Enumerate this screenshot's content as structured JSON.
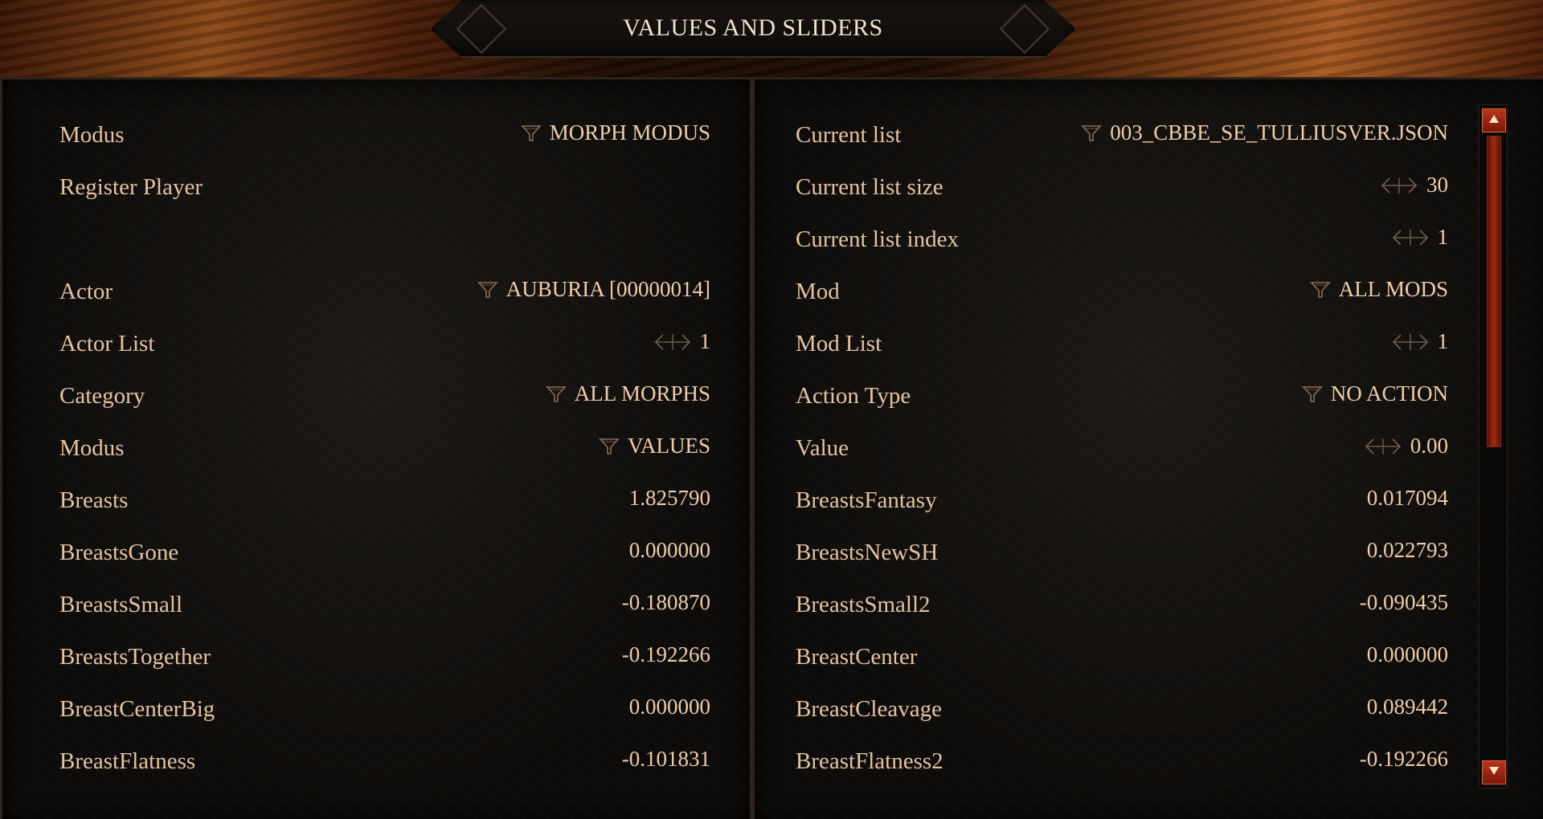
{
  "window": {
    "title": "VALUES AND SLIDERS"
  },
  "left_panel": {
    "rows": [
      {
        "label": "Modus",
        "value": "MORPH MODUS",
        "control": "dropdown"
      },
      {
        "label": "Register Player",
        "value": "",
        "control": "button"
      },
      {
        "label": "",
        "value": "",
        "control": "spacer"
      },
      {
        "label": "Actor",
        "value": "AUBURIA [00000014]",
        "control": "dropdown"
      },
      {
        "label": "Actor List",
        "value": "1",
        "control": "stepper"
      },
      {
        "label": "Category",
        "value": "ALL MORPHS",
        "control": "dropdown"
      },
      {
        "label": "Modus",
        "value": "VALUES",
        "control": "dropdown"
      },
      {
        "label": "Breasts",
        "value": "1.825790",
        "control": "value"
      },
      {
        "label": "BreastsGone",
        "value": "0.000000",
        "control": "value"
      },
      {
        "label": "BreastsSmall",
        "value": "-0.180870",
        "control": "value"
      },
      {
        "label": "BreastsTogether",
        "value": "-0.192266",
        "control": "value"
      },
      {
        "label": "BreastCenterBig",
        "value": "0.000000",
        "control": "value"
      },
      {
        "label": "BreastFlatness",
        "value": "-0.101831",
        "control": "value"
      }
    ]
  },
  "right_panel": {
    "rows": [
      {
        "label": "Current list",
        "value": "003_CBBE_SE_TULLIUSVER.JSON",
        "control": "dropdown"
      },
      {
        "label": "Current list size",
        "value": "30",
        "control": "stepper"
      },
      {
        "label": "Current list index",
        "value": "1",
        "control": "stepper"
      },
      {
        "label": "Mod",
        "value": "ALL MODS",
        "control": "dropdown"
      },
      {
        "label": "Mod List",
        "value": "1",
        "control": "stepper"
      },
      {
        "label": "Action Type",
        "value": "NO ACTION",
        "control": "dropdown"
      },
      {
        "label": "Value",
        "value": "0.00",
        "control": "stepper"
      },
      {
        "label": "BreastsFantasy",
        "value": "0.017094",
        "control": "value"
      },
      {
        "label": "BreastsNewSH",
        "value": "0.022793",
        "control": "value"
      },
      {
        "label": "BreastsSmall2",
        "value": "-0.090435",
        "control": "value"
      },
      {
        "label": "BreastCenter",
        "value": "0.000000",
        "control": "value"
      },
      {
        "label": "BreastCleavage",
        "value": "0.089442",
        "control": "value"
      },
      {
        "label": "BreastFlatness2",
        "value": "-0.192266",
        "control": "value"
      }
    ]
  },
  "scrollbar": {
    "position_fraction": 0.0,
    "visible_fraction": 0.5
  },
  "icons": {
    "dropdown": "funnel-icon",
    "stepper": "left-right-arrows-icon",
    "scroll_up": "triangle-up-icon",
    "scroll_down": "triangle-down-icon"
  },
  "colors": {
    "text": "#e6c3a0",
    "title": "#f1e3cf",
    "accent": "#b8341c"
  }
}
